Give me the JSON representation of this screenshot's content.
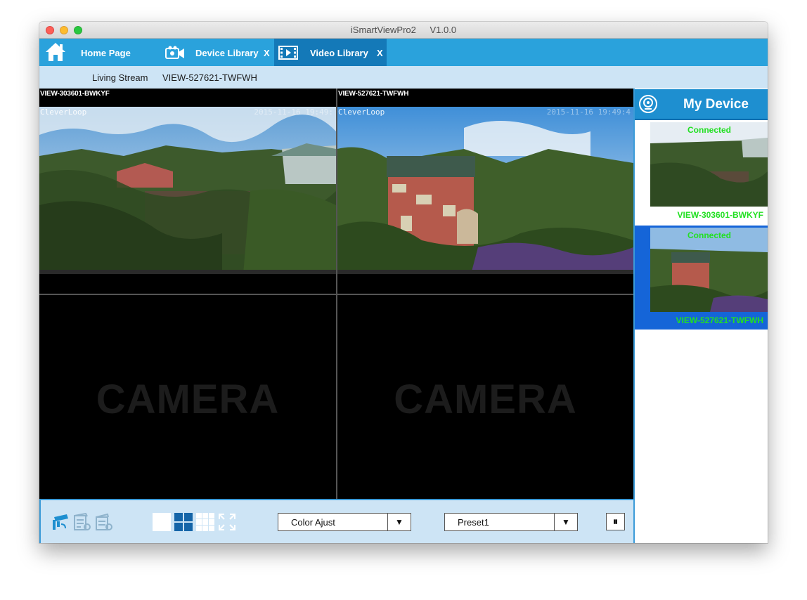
{
  "window": {
    "app_name": "iSmartViewPro2",
    "version": "V1.0.0"
  },
  "tabs": [
    {
      "label": "Home Page",
      "icon": "home-icon",
      "closable": false
    },
    {
      "label": "Device Library",
      "icon": "video-camera-icon",
      "closable": true,
      "close_label": "X"
    },
    {
      "label": "Video Library",
      "icon": "film-icon",
      "closable": true,
      "close_label": "X",
      "active": true
    }
  ],
  "subbar": {
    "stream_label": "Living Stream",
    "device": "VIEW-527621-TWFWH"
  },
  "cells": [
    {
      "name": "VIEW-303601-BWKYF",
      "overlay_left": "CleverLoop",
      "overlay_right": "2015-11-16 19:49:",
      "has_video": true
    },
    {
      "name": "VIEW-527621-TWFWH",
      "overlay_left": "CleverLoop",
      "overlay_right": "2015-11-16 19:49:4",
      "has_video": true
    },
    {
      "placeholder": "CAMERA",
      "has_video": false
    },
    {
      "placeholder": "CAMERA",
      "has_video": false
    }
  ],
  "toolbar": {
    "color_select": {
      "value": "Color Ajust",
      "arrow": "▼"
    },
    "preset_select": {
      "value": "Preset1",
      "arrow": "▼"
    },
    "pause_label": "⏸"
  },
  "sidepanel": {
    "title": "My Device",
    "devices": [
      {
        "status": "Connected",
        "name": "VIEW-303601-BWKYF",
        "selected": false
      },
      {
        "status": "Connected",
        "name": "VIEW-527621-TWFWH",
        "selected": true
      }
    ]
  },
  "colors": {
    "tabbar": "#2aa2dc",
    "tab_active": "#1479b8",
    "subbar": "#cde4f5",
    "accent_green": "#22e022",
    "selected": "#1565d8"
  }
}
